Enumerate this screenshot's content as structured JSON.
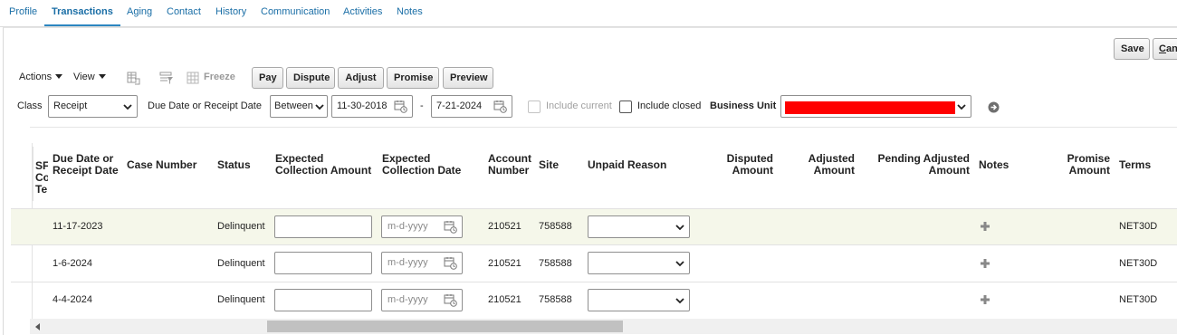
{
  "tabs": [
    "Profile",
    "Transactions",
    "Aging",
    "Contact",
    "History",
    "Communication",
    "Activities",
    "Notes"
  ],
  "top_buttons": {
    "save": "Save",
    "cancel_prefix": "C",
    "cancel_rest": "an"
  },
  "toolbar": {
    "actions": "Actions",
    "view": "View",
    "freeze": "Freeze",
    "buttons": {
      "pay": "Pay",
      "dispute": "Dispute",
      "adjust": "Adjust",
      "promise": "Promise",
      "preview": "Preview"
    }
  },
  "filters": {
    "class_label": "Class",
    "class_value": "Receipt",
    "date_label": "Due Date or Receipt Date",
    "date_op": "Between",
    "date_from": "11-30-2018",
    "date_sep": "-",
    "date_to": "7-21-2024",
    "include_current": "Include current",
    "include_closed": "Include closed",
    "business_unit_label": "Business Unit"
  },
  "table": {
    "headers": {
      "sf": [
        "SF",
        "Co",
        "Te"
      ],
      "due_date": [
        "Due Date or",
        "Receipt Date"
      ],
      "case_number": "Case Number",
      "status": "Status",
      "expected_amount": [
        "Expected",
        "Collection Amount"
      ],
      "expected_date": [
        "Expected",
        "Collection Date"
      ],
      "account_number": [
        "Account",
        "Number"
      ],
      "site": "Site",
      "unpaid_reason": "Unpaid Reason",
      "disputed": [
        "Disputed",
        "Amount"
      ],
      "adjusted": [
        "Adjusted",
        "Amount"
      ],
      "pending_adjusted": [
        "Pending Adjusted",
        "Amount"
      ],
      "notes": "Notes",
      "promise": [
        "Promise",
        "Amount"
      ],
      "terms": "Terms"
    },
    "date_placeholder": "m-d-yyyy",
    "rows": [
      {
        "due_date": "11-17-2023",
        "status": "Delinquent",
        "account": "210521",
        "site": "758588",
        "terms": "NET30D"
      },
      {
        "due_date": "1-6-2024",
        "status": "Delinquent",
        "account": "210521",
        "site": "758588",
        "terms": "NET30D"
      },
      {
        "due_date": "4-4-2024",
        "status": "Delinquent",
        "account": "210521",
        "site": "758588",
        "terms": "NET30D"
      }
    ]
  },
  "colors": {
    "link": "#1a6ea6",
    "selected_row": "#f5f7ea",
    "redacted": "#ff0000"
  }
}
